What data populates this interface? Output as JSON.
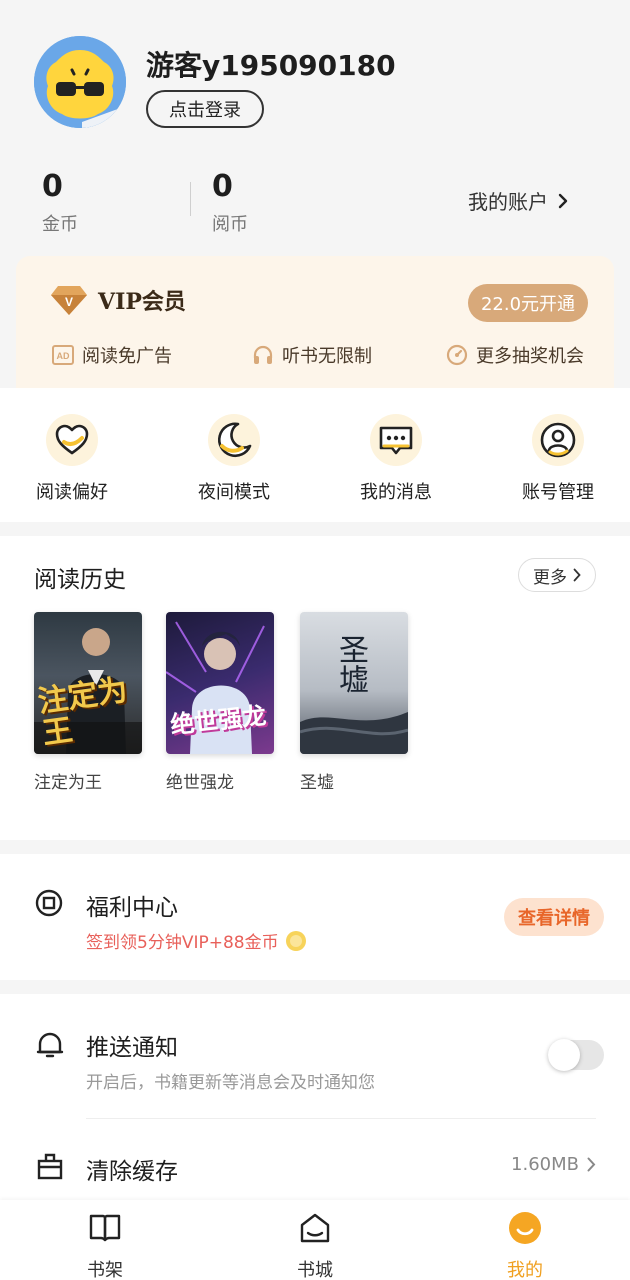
{
  "profile": {
    "username": "游客y195090180",
    "login_label": "点击登录",
    "avatar_icon": "sunglasses-face-icon"
  },
  "stats": {
    "gold": {
      "value": "0",
      "label": "金币"
    },
    "read_coins": {
      "value": "0",
      "label": "阅币"
    },
    "account_label": "我的账户"
  },
  "vip": {
    "title": "VIP会员",
    "button_label": "22.0元开通",
    "perks": [
      {
        "label": "阅读免广告",
        "icon": "ad-icon"
      },
      {
        "label": "听书无限制",
        "icon": "headphones-icon"
      },
      {
        "label": "更多抽奖机会",
        "icon": "lottery-icon"
      }
    ]
  },
  "quick_actions": [
    {
      "label": "阅读偏好",
      "icon": "heart-icon"
    },
    {
      "label": "夜间模式",
      "icon": "moon-icon"
    },
    {
      "label": "我的消息",
      "icon": "message-icon"
    },
    {
      "label": "账号管理",
      "icon": "user-circle-icon"
    }
  ],
  "history": {
    "title": "阅读历史",
    "more_label": "更多",
    "books": [
      {
        "title": "注定为王",
        "cover_text": "注定为王"
      },
      {
        "title": "绝世强龙",
        "cover_text": "绝世强龙"
      },
      {
        "title": "圣墟",
        "cover_text": "圣墟"
      }
    ]
  },
  "welfare": {
    "title": "福利中心",
    "subtitle": "签到领5分钟VIP+88金币",
    "button_label": "查看详情"
  },
  "settings": {
    "push": {
      "title": "推送通知",
      "subtitle": "开启后，书籍更新等消息会及时通知您",
      "enabled": false
    },
    "cache": {
      "title": "清除缓存",
      "value": "1.60MB"
    }
  },
  "tabs": [
    {
      "label": "书架",
      "icon": "bookshelf-icon",
      "active": false
    },
    {
      "label": "书城",
      "icon": "bookstore-icon",
      "active": false
    },
    {
      "label": "我的",
      "icon": "profile-smile-icon",
      "active": true
    }
  ],
  "colors": {
    "accent": "#f0a020",
    "vip_bg": "#fdf5ea",
    "vip_button": "#d8a97a",
    "welfare_red": "#e8605a",
    "welfare_button_bg": "#fde2cf"
  }
}
